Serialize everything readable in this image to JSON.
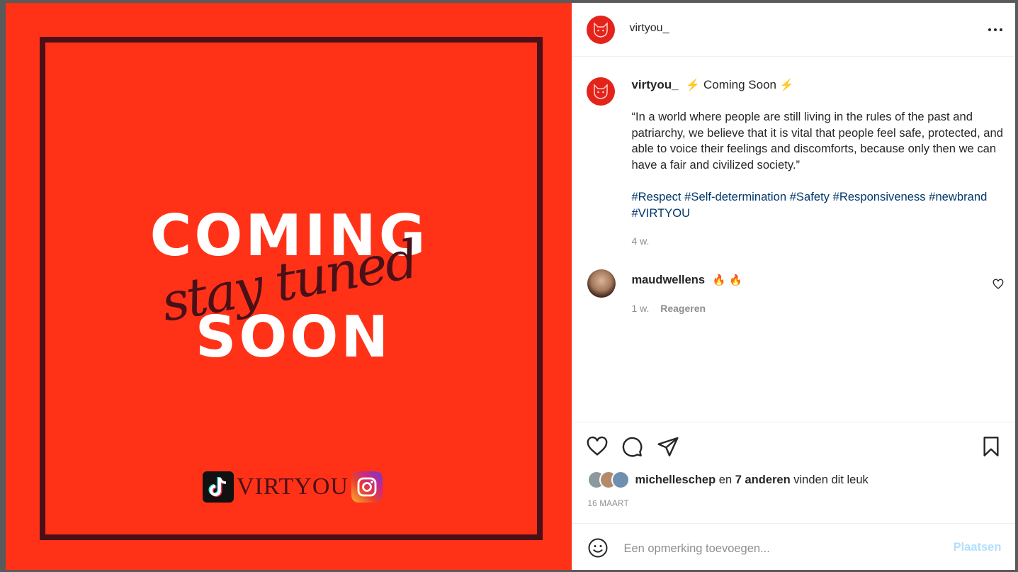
{
  "image": {
    "headline_top": "COMING",
    "headline_script": "stay tuned",
    "headline_bottom": "SOON",
    "brand_text": "VIRTYOU",
    "icons": [
      "tiktok-icon",
      "instagram-icon"
    ],
    "colors": {
      "background": "#ff3218",
      "frame": "#4a1018"
    }
  },
  "header": {
    "username": "virtyou_",
    "more_icon": "more-options-icon"
  },
  "caption": {
    "username": "virtyou_",
    "bolt": "⚡",
    "title": "Coming Soon",
    "text": "“In a world where people are still living in the rules of the past and patriarchy, we believe that it is vital that people feel safe, protected, and able to voice their feelings and discomforts, because only then we can have a fair and civilized society.”",
    "hashtags": [
      "#Respect",
      "#Self-determination",
      "#Safety",
      "#Responsiveness",
      "#newbrand",
      "#VIRTYOU"
    ],
    "time": "4 w."
  },
  "comment": {
    "username": "maudwellens",
    "emoji": "🔥",
    "time": "1 w.",
    "reply_label": "Reageren"
  },
  "likes": {
    "first_liker": "michelleschep",
    "joiner": "en",
    "others": "7 anderen",
    "suffix": "vinden dit leuk"
  },
  "post_date": "16 MAART",
  "comment_input": {
    "placeholder": "Een opmerking toevoegen...",
    "submit_label": "Plaatsen"
  }
}
